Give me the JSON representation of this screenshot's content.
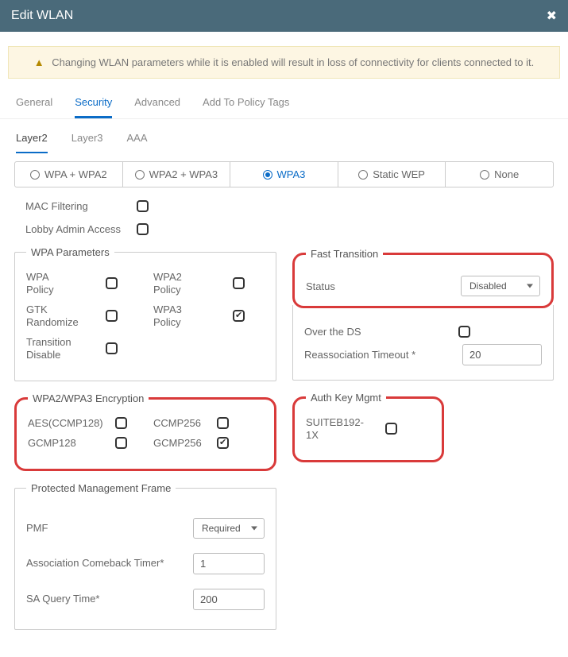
{
  "window": {
    "title": "Edit WLAN",
    "close": "✖"
  },
  "alert": {
    "text": "Changing WLAN parameters while it is enabled will result in loss of connectivity for clients connected to it."
  },
  "tabs": {
    "general": "General",
    "security": "Security",
    "advanced": "Advanced",
    "policy": "Add To Policy Tags"
  },
  "subtabs": {
    "layer2": "Layer2",
    "layer3": "Layer3",
    "aaa": "AAA"
  },
  "segments": {
    "wpa_wpa2": "WPA + WPA2",
    "wpa2_wpa3": "WPA2 + WPA3",
    "wpa3": "WPA3",
    "static_wep": "Static WEP",
    "none": "None"
  },
  "toggles": {
    "mac_filtering": "MAC Filtering",
    "lobby_admin": "Lobby Admin Access"
  },
  "wpa_params": {
    "legend": "WPA Parameters",
    "wpa_policy": "WPA\nPolicy",
    "gtk_randomize": "GTK\nRandomize",
    "transition_disable": "Transition\nDisable",
    "wpa2_policy": "WPA2\nPolicy",
    "wpa3_policy": "WPA3\nPolicy"
  },
  "encryption": {
    "legend": "WPA2/WPA3 Encryption",
    "aes_ccmp128": "AES(CCMP128)",
    "gcmp128": "GCMP128",
    "ccmp256": "CCMP256",
    "gcmp256": "GCMP256"
  },
  "pmf": {
    "legend": "Protected Management Frame",
    "pmf_label": "PMF",
    "pmf_value": "Required",
    "assoc_label": "Association Comeback Timer*",
    "assoc_value": "1",
    "sa_label": "SA Query Time*",
    "sa_value": "200"
  },
  "ft": {
    "legend": "Fast Transition",
    "status_label": "Status",
    "status_value": "Disabled",
    "over_ds": "Over the DS",
    "reassoc_label": "Reassociation Timeout *",
    "reassoc_value": "20"
  },
  "akm": {
    "legend": "Auth Key Mgmt",
    "suiteb": "SUITEB192-\n1X"
  }
}
